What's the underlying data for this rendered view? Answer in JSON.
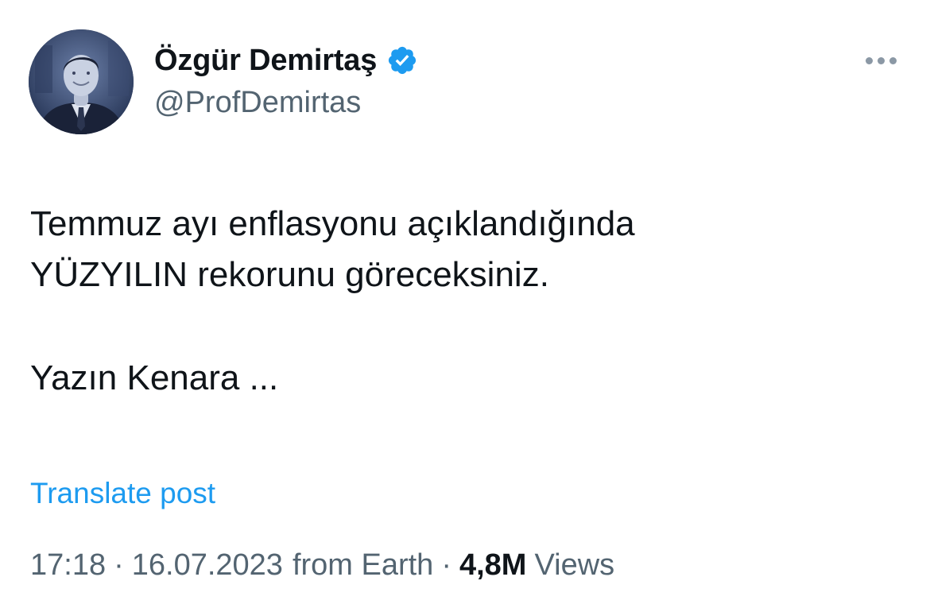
{
  "author": {
    "display_name": "Özgür Demirtaş",
    "handle": "@ProfDemirtas",
    "verified_icon": "verified-badge-icon",
    "verified_color": "#1d9bf0"
  },
  "post": {
    "lines": [
      "Temmuz ayı enflasyonu açıklandığında",
      "YÜZYILIN rekorunu göreceksiniz.",
      "Yazın Kenara ..."
    ]
  },
  "translate_label": "Translate post",
  "meta": {
    "time": "17:18",
    "separator": "·",
    "date": "16.07.2023",
    "location": "from Earth",
    "views_count": "4,8M",
    "views_label": "Views"
  },
  "colors": {
    "text": "#0f1419",
    "secondary": "#536471",
    "link": "#1d9bf0",
    "more_dots": "#8b98a5"
  },
  "icons": {
    "more": "more-horizontal-icon"
  }
}
